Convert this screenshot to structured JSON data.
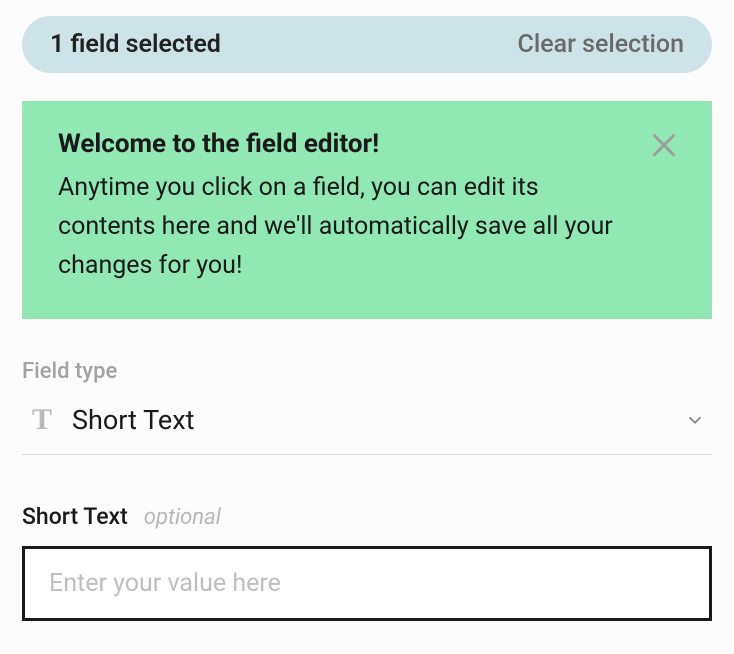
{
  "selection": {
    "count_text": "1 field selected",
    "clear_label": "Clear selection"
  },
  "welcome": {
    "title": "Welcome to the field editor!",
    "body": "Anytime you click on a field, you can edit its contents here and we'll automatically save all your changes for you!"
  },
  "field_type": {
    "label": "Field type",
    "value": "Short Text",
    "icon_glyph": "T"
  },
  "input": {
    "label": "Short Text",
    "optional_label": "optional",
    "placeholder": "Enter your value here",
    "value": ""
  }
}
